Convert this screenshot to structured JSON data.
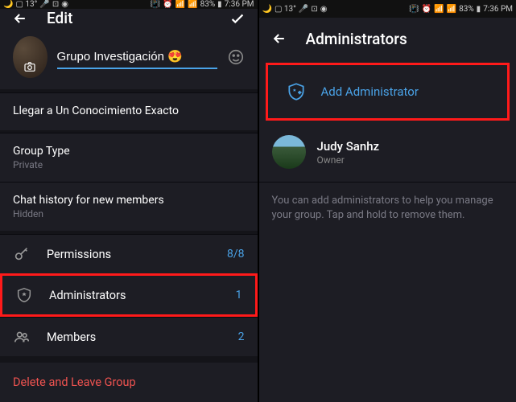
{
  "statusbar": {
    "temp": "13°",
    "battery": "83%",
    "time": "7:36 PM"
  },
  "left": {
    "title": "Edit",
    "group_name": "Grupo Investigación 😍",
    "description": "Llegar a Un Conocimiento Exacto",
    "group_type_label": "Group Type",
    "group_type_value": "Private",
    "chat_history_label": "Chat history for new members",
    "chat_history_value": "Hidden",
    "permissions_label": "Permissions",
    "permissions_value": "8/8",
    "administrators_label": "Administrators",
    "administrators_value": "1",
    "members_label": "Members",
    "members_value": "2",
    "delete_label": "Delete and Leave Group"
  },
  "right": {
    "title": "Administrators",
    "add_label": "Add Administrator",
    "member_name": "Judy Sanhz",
    "member_role": "Owner",
    "info_text": "You can add administrators to help you manage your group. Tap and hold to remove them."
  }
}
